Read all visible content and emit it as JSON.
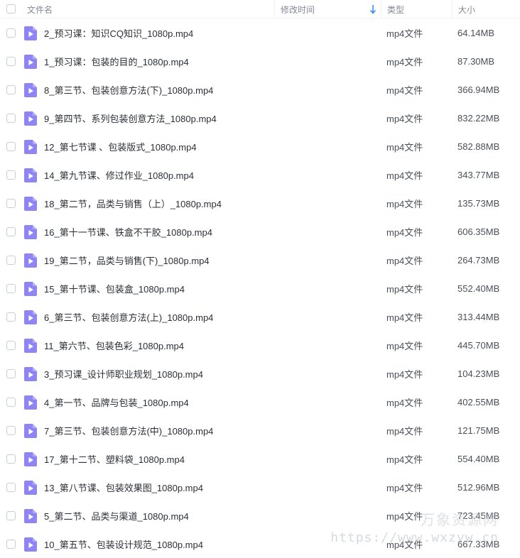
{
  "header": {
    "col_name": "文件名",
    "col_mtime": "修改时间",
    "col_type": "类型",
    "col_size": "大小",
    "sort_icon": "arrow-down-icon",
    "accent_color": "#3b8cff"
  },
  "file_icon": "video-file-icon",
  "file_icon_color": "#8e84f3",
  "files": [
    {
      "name": "2_预习课：知识CQ知识_1080p.mp4",
      "type": "mp4文件",
      "size": "64.14MB"
    },
    {
      "name": "1_预习课：包装的目的_1080p.mp4",
      "type": "mp4文件",
      "size": "87.30MB"
    },
    {
      "name": "8_第三节、包装创意方法(下)_1080p.mp4",
      "type": "mp4文件",
      "size": "366.94MB"
    },
    {
      "name": "9_第四节、系列包装创意方法_1080p.mp4",
      "type": "mp4文件",
      "size": "832.22MB"
    },
    {
      "name": "12_第七节课 、包装版式_1080p.mp4",
      "type": "mp4文件",
      "size": "582.88MB"
    },
    {
      "name": "14_第九节课、修过作业_1080p.mp4",
      "type": "mp4文件",
      "size": "343.77MB"
    },
    {
      "name": "18_第二节，品类与销售（上）_1080p.mp4",
      "type": "mp4文件",
      "size": "135.73MB"
    },
    {
      "name": "16_第十一节课、铁盒不干胶_1080p.mp4",
      "type": "mp4文件",
      "size": "606.35MB"
    },
    {
      "name": "19_第二节，品类与销售(下)_1080p.mp4",
      "type": "mp4文件",
      "size": "264.73MB"
    },
    {
      "name": "15_第十节课、包装盒_1080p.mp4",
      "type": "mp4文件",
      "size": "552.40MB"
    },
    {
      "name": "6_第三节、包装创意方法(上)_1080p.mp4",
      "type": "mp4文件",
      "size": "313.44MB"
    },
    {
      "name": "11_第六节、包装色彩_1080p.mp4",
      "type": "mp4文件",
      "size": "445.70MB"
    },
    {
      "name": "3_预习课_设计师职业规划_1080p.mp4",
      "type": "mp4文件",
      "size": "104.23MB"
    },
    {
      "name": "4_第一节、品牌与包装_1080p.mp4",
      "type": "mp4文件",
      "size": "402.55MB"
    },
    {
      "name": "7_第三节、包装创意方法(中)_1080p.mp4",
      "type": "mp4文件",
      "size": "121.75MB"
    },
    {
      "name": "17_第十二节、塑料袋_1080p.mp4",
      "type": "mp4文件",
      "size": "554.40MB"
    },
    {
      "name": "13_第八节课、包装效果图_1080p.mp4",
      "type": "mp4文件",
      "size": "512.96MB"
    },
    {
      "name": "5_第二节、品类与渠道_1080p.mp4",
      "type": "mp4文件",
      "size": "723.45MB"
    },
    {
      "name": "10_第五节、包装设计规范_1080p.mp4",
      "type": "mp4文件",
      "size": "667.33MB"
    }
  ],
  "watermark": {
    "brand": "万象资源网",
    "url": "https://www.wxzyw.cn"
  }
}
